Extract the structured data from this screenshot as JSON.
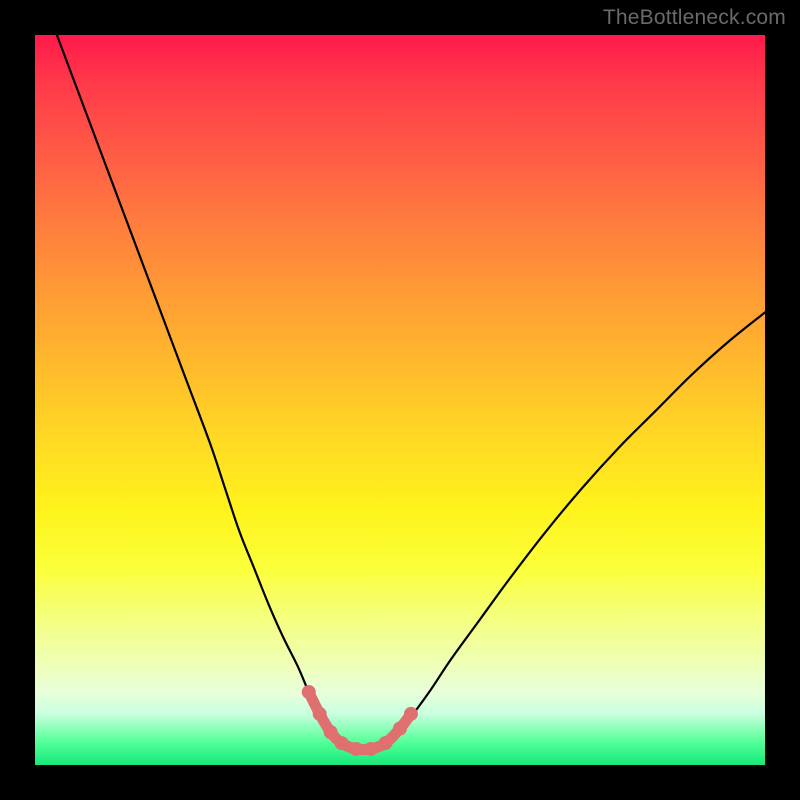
{
  "watermark": "TheBottleneck.com",
  "chart_data": {
    "type": "line",
    "title": "",
    "xlabel": "",
    "ylabel": "",
    "xlim": [
      0,
      100
    ],
    "ylim": [
      0,
      100
    ],
    "grid": false,
    "legend": false,
    "series": [
      {
        "name": "bottleneck-curve",
        "x": [
          3,
          6,
          9,
          12,
          15,
          18,
          21,
          24,
          26,
          28,
          30,
          32,
          34,
          36,
          37.5,
          39,
          40.5,
          42,
          44,
          46,
          48,
          51,
          54,
          57,
          61,
          65,
          70,
          75,
          80,
          85,
          90,
          95,
          100
        ],
        "y": [
          100,
          92,
          84,
          76,
          68,
          60,
          52,
          44,
          38,
          32,
          27,
          22,
          17.5,
          13.5,
          10,
          7,
          4.5,
          3,
          2.2,
          2.2,
          3,
          6,
          10,
          14.5,
          20,
          25.5,
          32,
          38,
          43.5,
          48.5,
          53.5,
          58,
          62
        ]
      },
      {
        "name": "trough-highlight",
        "x": [
          37.5,
          39,
          40.5,
          42,
          44,
          46,
          48,
          50,
          51.5
        ],
        "y": [
          10,
          7,
          4.5,
          3,
          2.2,
          2.2,
          3,
          5,
          7
        ]
      }
    ],
    "annotations": []
  },
  "colors": {
    "curve": "#000000",
    "highlight": "#e07070",
    "highlight_dot": "#e07070",
    "background_top": "#ff1a4b",
    "background_bottom": "#17e87a"
  }
}
